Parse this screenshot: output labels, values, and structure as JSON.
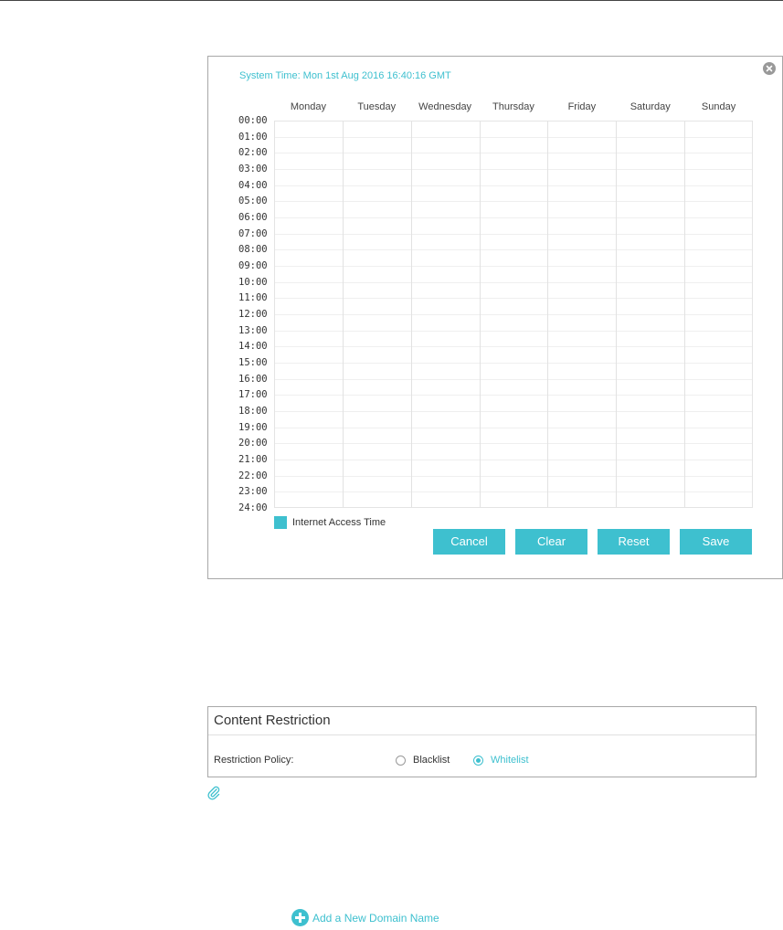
{
  "schedule": {
    "system_time": "System Time: Mon 1st Aug 2016 16:40:16 GMT",
    "days": [
      "Monday",
      "Tuesday",
      "Wednesday",
      "Thursday",
      "Friday",
      "Saturday",
      "Sunday"
    ],
    "hours": [
      "00:00",
      "01:00",
      "02:00",
      "03:00",
      "04:00",
      "05:00",
      "06:00",
      "07:00",
      "08:00",
      "09:00",
      "10:00",
      "11:00",
      "12:00",
      "13:00",
      "14:00",
      "15:00",
      "16:00",
      "17:00",
      "18:00",
      "19:00",
      "20:00",
      "21:00",
      "22:00",
      "23:00",
      "24:00"
    ],
    "legend_label": "Internet Access Time",
    "buttons": {
      "cancel": "Cancel",
      "clear": "Clear",
      "reset": "Reset",
      "save": "Save"
    }
  },
  "content_restriction": {
    "title": "Content Restriction",
    "policy_label": "Restriction Policy:",
    "options": [
      "Blacklist",
      "Whitelist"
    ],
    "selected": "Whitelist"
  },
  "add_domain": {
    "label": "Add a New Domain Name"
  },
  "colors": {
    "accent": "#3ec0cf",
    "border": "#a8a8a8"
  },
  "icons": [
    "close-icon",
    "paperclip-icon",
    "add-circle-icon"
  ]
}
